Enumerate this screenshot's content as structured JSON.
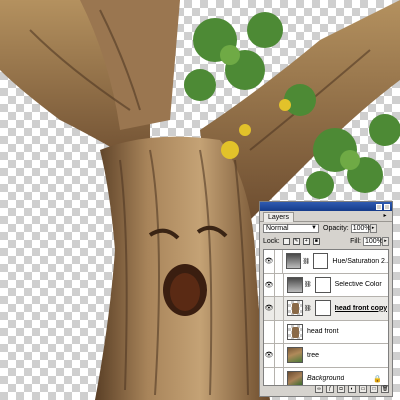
{
  "panel": {
    "tab_label": "Layers",
    "blend_mode": "Normal",
    "opacity_label": "Opacity:",
    "opacity_value": "100%",
    "lock_label": "Lock:",
    "fill_label": "Fill:",
    "fill_value": "100%",
    "layers": [
      {
        "name": "Hue/Saturation 2...",
        "type": "adjustment",
        "visible": true
      },
      {
        "name": "Selective Color",
        "type": "adjustment",
        "visible": true
      },
      {
        "name": "head front copy",
        "type": "pixel-mask",
        "visible": true,
        "selected": true
      },
      {
        "name": "head front",
        "type": "pixel",
        "visible": false
      },
      {
        "name": "tree",
        "type": "pixel",
        "visible": true
      },
      {
        "name": "Background",
        "type": "background",
        "visible": true,
        "locked": true
      }
    ]
  },
  "colors": {
    "title_bar": "#2f5bb1",
    "panel_bg": "#d6d3ce",
    "bark": "#8a6a48",
    "foliage": "#4d8a35",
    "leaf_yellow": "#e2c22a"
  },
  "icons": [
    "eye-icon",
    "link-icon",
    "lock-icon",
    "brush-icon",
    "layer-style-icon",
    "mask-icon",
    "adjustment-icon",
    "folder-icon",
    "new-layer-icon",
    "trash-icon"
  ]
}
